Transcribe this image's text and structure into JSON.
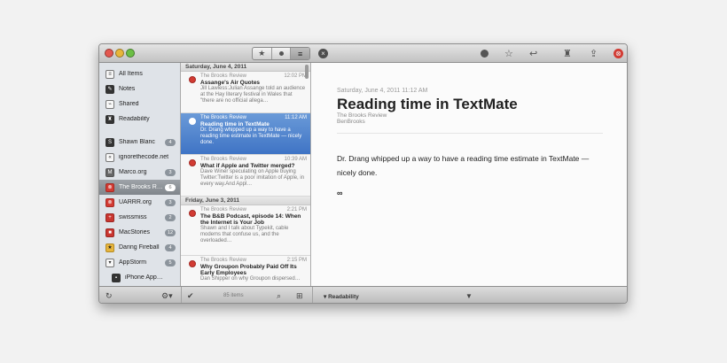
{
  "toolbar": {
    "seg_buttons": [
      "★",
      "",
      "≡"
    ],
    "close_glyph": "×",
    "right_icons": [
      "●",
      "☆",
      "↩",
      "♜",
      "⇪",
      "⊗"
    ]
  },
  "sidebar": {
    "items": [
      {
        "label": "All Items",
        "icon": "≡",
        "badge": ""
      },
      {
        "label": "Notes",
        "icon": "✎",
        "badge": ""
      },
      {
        "label": "Shared",
        "icon": "⌁",
        "badge": ""
      },
      {
        "label": "Readability",
        "icon": "♜",
        "badge": ""
      },
      {
        "label": "Shawn Blanc",
        "icon": "S",
        "badge": "4"
      },
      {
        "label": "ignorethecode.net",
        "icon": "«",
        "badge": ""
      },
      {
        "label": "Marco.org",
        "icon": "M",
        "badge": "3"
      },
      {
        "label": "The Brooks R…",
        "icon": "⊗",
        "badge": "6"
      },
      {
        "label": "UARRR.org",
        "icon": "⊗",
        "badge": "3"
      },
      {
        "label": "swissmiss",
        "icon": "+",
        "badge": "2"
      },
      {
        "label": "MacStories",
        "icon": "■",
        "badge": "12"
      },
      {
        "label": "Daring Fireball",
        "icon": "★",
        "badge": "4"
      },
      {
        "label": "AppStorm",
        "icon": "▾",
        "badge": "5"
      },
      {
        "label": "iPhone App…",
        "icon": "▪",
        "badge": ""
      }
    ]
  },
  "list": {
    "date1": "Saturday, June 4, 2011",
    "date2": "Friday, June 3, 2011",
    "articles": [
      {
        "source": "The Brooks Review",
        "time": "12:02 PM",
        "title": "Assange's Air Quotes",
        "excerpt": "Jill Lawless:Julian Assange told an audience at the Hay literary festival in Wales that \"there are no official allega…"
      },
      {
        "source": "The Brooks Review",
        "time": "11:12 AM",
        "title": "Reading time in TextMate",
        "excerpt": "Dr. Drang whipped up a way to have a reading time estimate in TextMate — nicely done."
      },
      {
        "source": "The Brooks Review",
        "time": "10:39 AM",
        "title": "What if Apple and Twitter merged?",
        "excerpt": "Dave Winer speculating on Apple buying Twitter:Twitter is a poor imitation of Apple, in every way.And Appl…"
      },
      {
        "source": "The Brooks Review",
        "time": "2:21 PM",
        "title": "The B&B Podcast, episode 14: When the Internet is Your Job",
        "excerpt": "Shawn and I talk about Typekit, cable modems that confuse us, and the overloaded…"
      },
      {
        "source": "The Brooks Review",
        "time": "2:15 PM",
        "title": "Why Groupon Probably Paid Off Its Early Employees",
        "excerpt": "Dan Shipper on why Groupon dispersed…"
      }
    ]
  },
  "reader": {
    "date": "Saturday, June 4, 2011 11:12 AM",
    "title": "Reading time in TextMate",
    "source": "The Brooks Review",
    "author": "BenBrooks",
    "body": "Dr. Drang whipped up a way to have a reading time estimate in TextMate — nicely done.",
    "link": "∞"
  },
  "bottombar": {
    "refresh": "↻",
    "gear": "⚙▾",
    "check": "✔",
    "count": "85 items",
    "search": "⌕",
    "add": "⊞",
    "readability": "▾ Readability",
    "triangle": "▼"
  }
}
